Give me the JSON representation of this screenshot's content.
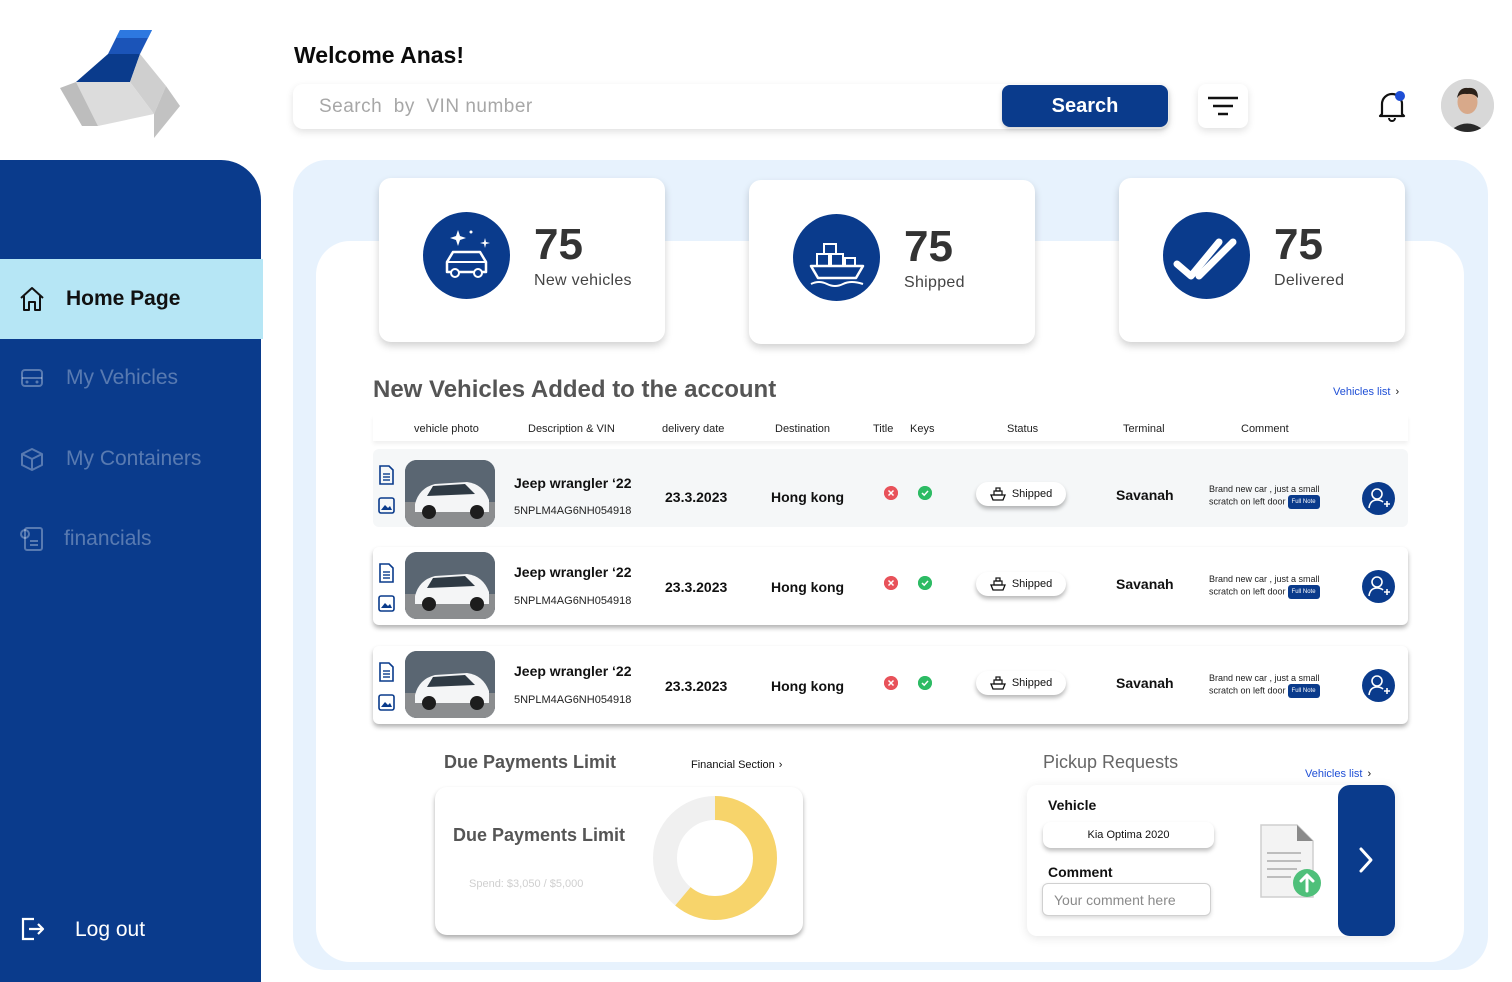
{
  "header": {
    "welcome": "Welcome Anas!",
    "search_placeholder": "Search  by  VIN number",
    "search_button": "Search"
  },
  "sidebar": {
    "items": [
      {
        "label": "Home Page",
        "icon": "home-icon",
        "active": true
      },
      {
        "label": "My Vehicles",
        "icon": "car-icon",
        "active": false
      },
      {
        "label": "My Containers",
        "icon": "box-icon",
        "active": false
      },
      {
        "label": "financials",
        "icon": "finance-icon",
        "active": false
      }
    ],
    "logout": "Log out"
  },
  "stats": [
    {
      "value": "75",
      "label": "New vehicles",
      "icon": "car-sparkle-icon"
    },
    {
      "value": "75",
      "label": "Shipped",
      "icon": "ship-icon"
    },
    {
      "value": "75",
      "label": "Delivered",
      "icon": "double-check-icon"
    }
  ],
  "vehicles_section": {
    "title": "New Vehicles Added to the account",
    "link": "Vehicles list",
    "columns": [
      "vehicle photo",
      "Description & VIN",
      "delivery date",
      "Destination",
      "Title",
      "Keys",
      "Status",
      "Terminal",
      "Comment"
    ],
    "rows": [
      {
        "name": "Jeep wrangler ‘22",
        "vin": "5NPLM4AG6NH054918",
        "date": "23.3.2023",
        "destination": "Hong kong",
        "title": false,
        "keys": true,
        "status": "Shipped",
        "terminal": "Savanah",
        "comment": "Brand new car , just a small scratch on left door",
        "note_btn": "Full Note"
      },
      {
        "name": "Jeep wrangler ‘22",
        "vin": "5NPLM4AG6NH054918",
        "date": "23.3.2023",
        "destination": "Hong kong",
        "title": false,
        "keys": true,
        "status": "Shipped",
        "terminal": "Savanah",
        "comment": "Brand new car , just a small scratch on left door",
        "note_btn": "Full Note"
      },
      {
        "name": "Jeep wrangler ‘22",
        "vin": "5NPLM4AG6NH054918",
        "date": "23.3.2023",
        "destination": "Hong kong",
        "title": false,
        "keys": true,
        "status": "Shipped",
        "terminal": "Savanah",
        "comment": "Brand new car , just a small scratch on left door",
        "note_btn": "Full Note"
      }
    ]
  },
  "due_payments": {
    "section_title": "Due Payments Limit",
    "link": "Financial Section",
    "card_title": "Due Payments Limit",
    "spend": "Spend: $3,050 / $5,000",
    "spent_fraction": 0.61
  },
  "pickup": {
    "title": "Pickup Requests",
    "link": "Vehicles list",
    "vehicle_label": "Vehicle",
    "vehicle_value": "Kia Optima 2020",
    "comment_label": "Comment",
    "comment_placeholder": "Your comment here"
  },
  "colors": {
    "primary": "#0a3b8c",
    "active_nav": "#b6e6f5",
    "panel_bg": "#e7f2fd",
    "donut": "#f7d46b",
    "error": "#e8525a",
    "success": "#2dbb64"
  }
}
